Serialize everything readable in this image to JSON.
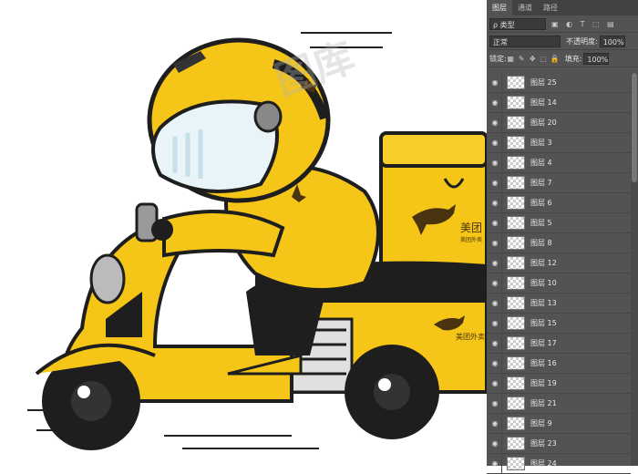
{
  "panel": {
    "tabs": [
      "图层",
      "通道",
      "路径"
    ],
    "filter": {
      "label": "ρ 类型"
    },
    "blend_mode": "正常",
    "opacity_label": "不透明度:",
    "opacity_value": "100%",
    "lock_label": "锁定:",
    "fill_label": "填充:",
    "fill_value": "100%",
    "layers": [
      {
        "name": "图层 25"
      },
      {
        "name": "图层 14"
      },
      {
        "name": "图层 20"
      },
      {
        "name": "图层 3"
      },
      {
        "name": "图层 4"
      },
      {
        "name": "图层 7"
      },
      {
        "name": "图层 6"
      },
      {
        "name": "图层 5"
      },
      {
        "name": "图层 8"
      },
      {
        "name": "图层 12"
      },
      {
        "name": "图层 10"
      },
      {
        "name": "图层 13"
      },
      {
        "name": "图层 15"
      },
      {
        "name": "图层 17"
      },
      {
        "name": "图层 16"
      },
      {
        "name": "图层 19"
      },
      {
        "name": "图层 21"
      },
      {
        "name": "图层 9"
      },
      {
        "name": "图层 23"
      },
      {
        "name": "图层 24"
      }
    ]
  },
  "artwork": {
    "brand_text": "美团",
    "brand_sub": "美团外卖",
    "side_text": "美团外卖",
    "watermark": "图库"
  },
  "colors": {
    "yellow": "#f5c518",
    "dark": "#1e1e1e",
    "panel": "#535353"
  }
}
